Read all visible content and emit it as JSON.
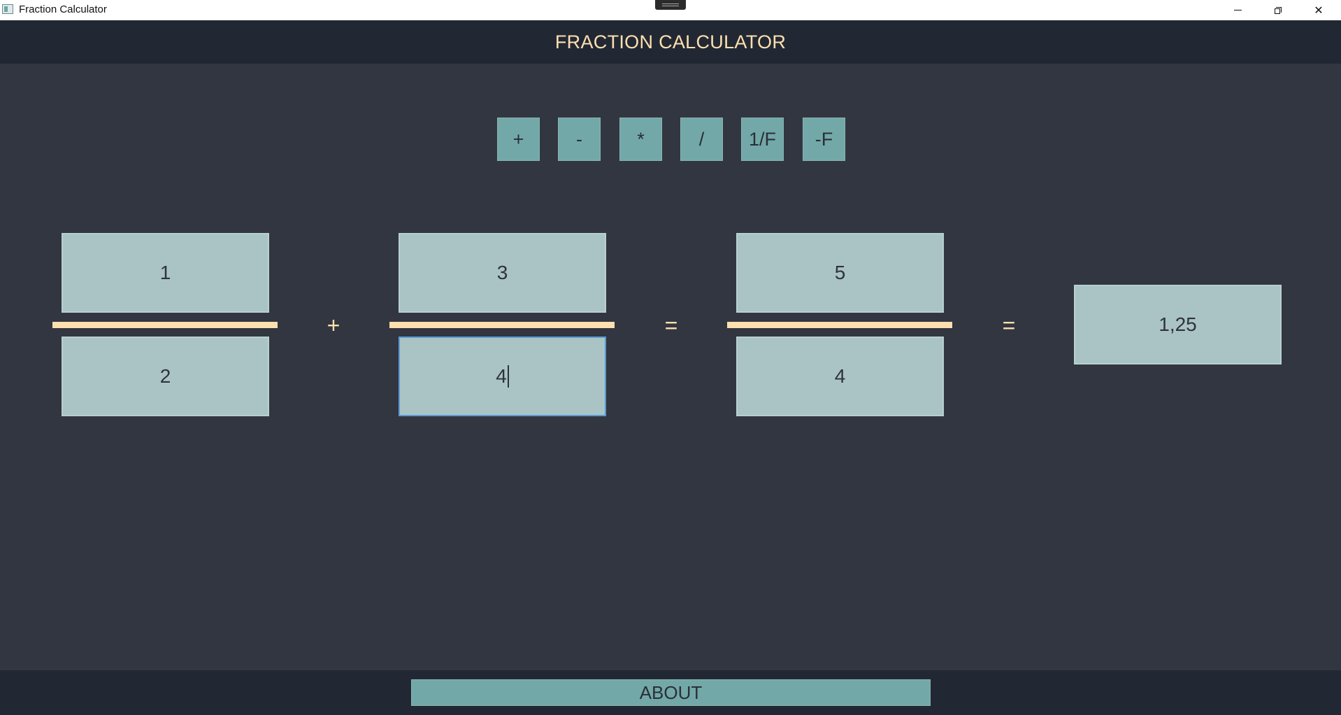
{
  "window": {
    "title": "Fraction Calculator"
  },
  "header": {
    "title": "FRACTION CALCULATOR"
  },
  "operations": [
    {
      "label": "+"
    },
    {
      "label": "-"
    },
    {
      "label": "*"
    },
    {
      "label": "/"
    },
    {
      "label": "1/F"
    },
    {
      "label": "-F"
    }
  ],
  "operand1": {
    "numerator": "1",
    "denominator": "2"
  },
  "operator": "+",
  "operand2": {
    "numerator": "3",
    "denominator": "4"
  },
  "equals_1": "=",
  "result": {
    "numerator": "5",
    "denominator": "4"
  },
  "equals_2": "=",
  "decimal_result": "1,25",
  "footer": {
    "about_label": "ABOUT"
  },
  "colors": {
    "background": "#323640",
    "header": "#222833",
    "accent": "#fde0b0",
    "button": "#73a8a8",
    "field": "#aac4c5"
  }
}
